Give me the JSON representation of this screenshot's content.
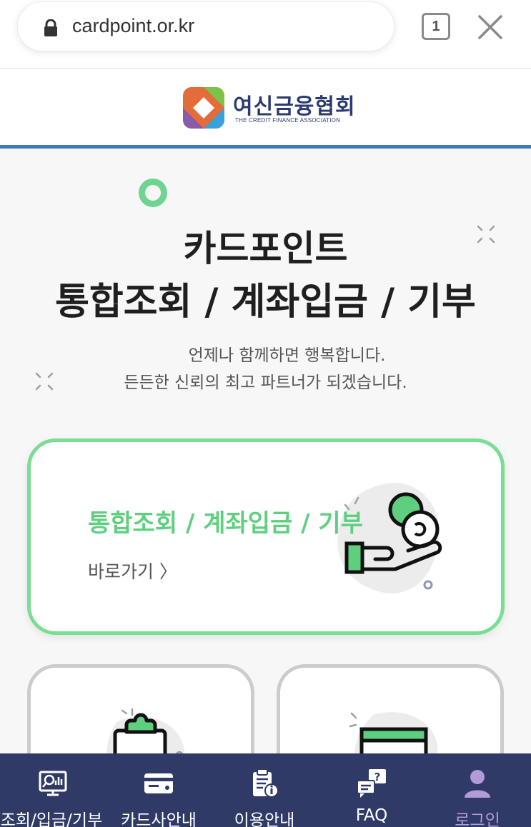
{
  "browser": {
    "url": "cardpoint.or.kr",
    "tab_count": "1"
  },
  "header": {
    "logo_text": "여신금융협회",
    "logo_subtext": "THE CREDIT FINANCE ASSOCIATION"
  },
  "hero": {
    "title_line1": "카드포인트",
    "title_line2": "통합조회 / 계좌입금 / 기부",
    "subtitle_line1": "언제나 함께하면 행복합니다.",
    "subtitle_line2": "든든한 신뢰의 최고 파트너가 되겠습니다."
  },
  "main_card": {
    "title": "통합조회 / 계좌입금 / 기부",
    "link_label": "바로가기 〉"
  },
  "bottom_nav": {
    "items": [
      {
        "label": "조회/입금/기부",
        "icon": "monitor-search-icon"
      },
      {
        "label": "카드사안내",
        "icon": "card-icon"
      },
      {
        "label": "이용안내",
        "icon": "clipboard-info-icon"
      },
      {
        "label": "FAQ",
        "icon": "faq-icon"
      },
      {
        "label": "로그인",
        "icon": "user-icon"
      }
    ],
    "active_index": 4
  },
  "colors": {
    "accent_green": "#5fcf7f",
    "header_blue": "#3d7bb5",
    "nav_bg": "#2f3a67",
    "nav_active": "#b39ad8"
  }
}
